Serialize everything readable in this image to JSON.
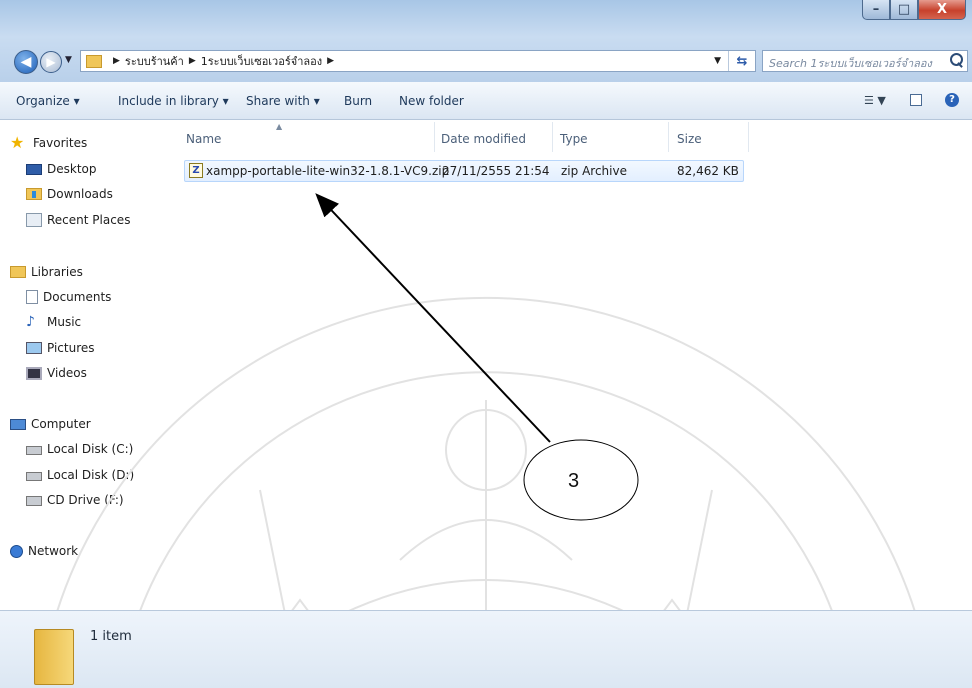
{
  "window": {
    "minimize_label": "–",
    "maximize_label": "□",
    "close_label": "X"
  },
  "address": {
    "crumbs": [
      "ระบบร้านค้า",
      "1ระบบเว็บเซอเวอร์จำลอง"
    ],
    "search_placeholder": "Search 1ระบบเว็บเซอเวอร์จำลอง"
  },
  "toolbar": {
    "organize": "Organize ▾",
    "include_in_library": "Include in library ▾",
    "share_with": "Share with ▾",
    "burn": "Burn",
    "new_folder": "New folder"
  },
  "sidebar": {
    "favorites": {
      "label": "Favorites",
      "items": [
        "Desktop",
        "Downloads",
        "Recent Places"
      ]
    },
    "libraries": {
      "label": "Libraries",
      "items": [
        "Documents",
        "Music",
        "Pictures",
        "Videos"
      ]
    },
    "computer": {
      "label": "Computer",
      "items": [
        "Local Disk (C:)",
        "Local Disk (D:)",
        "CD Drive (F:)"
      ]
    },
    "network": {
      "label": "Network"
    }
  },
  "columns": {
    "name": "Name",
    "date_modified": "Date modified",
    "type": "Type",
    "size": "Size"
  },
  "files": [
    {
      "name": "xampp-portable-lite-win32-1.8.1-VC9.zip",
      "date_modified": "27/11/2555 21:54",
      "type": "zip Archive",
      "size": "82,462 KB"
    }
  ],
  "details": {
    "count": "1 item"
  },
  "annotation": {
    "label": "3"
  }
}
